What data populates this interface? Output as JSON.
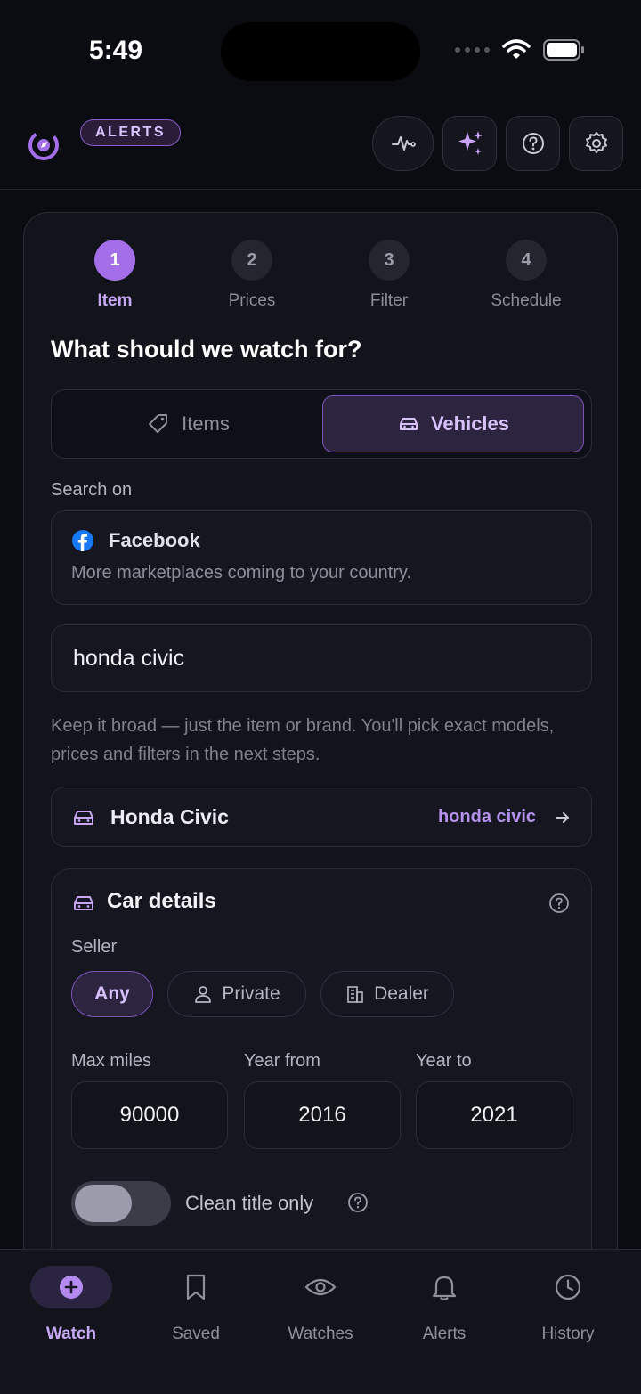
{
  "status": {
    "time": "5:49"
  },
  "header": {
    "badge": "ALERTS",
    "buttons": [
      "activity-icon",
      "sparkles-icon",
      "help-icon",
      "settings-icon"
    ]
  },
  "steps": [
    {
      "num": "1",
      "label": "Item",
      "active": true
    },
    {
      "num": "2",
      "label": "Prices",
      "active": false
    },
    {
      "num": "3",
      "label": "Filter",
      "active": false
    },
    {
      "num": "4",
      "label": "Schedule",
      "active": false
    }
  ],
  "form": {
    "title": "What should we watch for?",
    "segments": {
      "items": "Items",
      "vehicles": "Vehicles",
      "selected": "vehicles"
    },
    "search_on_label": "Search on",
    "marketplace": {
      "name": "Facebook",
      "note": "More marketplaces coming to your country."
    },
    "query": "honda civic",
    "hint": "Keep it broad — just the item or brand. You'll pick exact models, prices and filters in the next steps.",
    "suggestion": {
      "title": "Honda Civic",
      "query": "honda civic"
    }
  },
  "car_details": {
    "title": "Car details",
    "seller_label": "Seller",
    "seller_options": [
      "Any",
      "Private",
      "Dealer"
    ],
    "seller_selected": "Any",
    "max_miles_label": "Max miles",
    "year_from_label": "Year from",
    "year_to_label": "Year to",
    "max_miles": "90000",
    "year_from": "2016",
    "year_to": "2021",
    "clean_title_label": "Clean title only",
    "clean_title_on": false
  },
  "nav": {
    "items": [
      {
        "label": "Watch",
        "icon": "plus-circle-icon",
        "active": true
      },
      {
        "label": "Saved",
        "icon": "bookmark-icon",
        "active": false
      },
      {
        "label": "Watches",
        "icon": "eye-icon",
        "active": false
      },
      {
        "label": "Alerts",
        "icon": "bell-icon",
        "active": false
      },
      {
        "label": "History",
        "icon": "clock-icon",
        "active": false
      }
    ]
  },
  "colors": {
    "accent": "#a46ee8",
    "background": "#0b0c12",
    "card": "#12131b",
    "facebook": "#1877f2"
  }
}
